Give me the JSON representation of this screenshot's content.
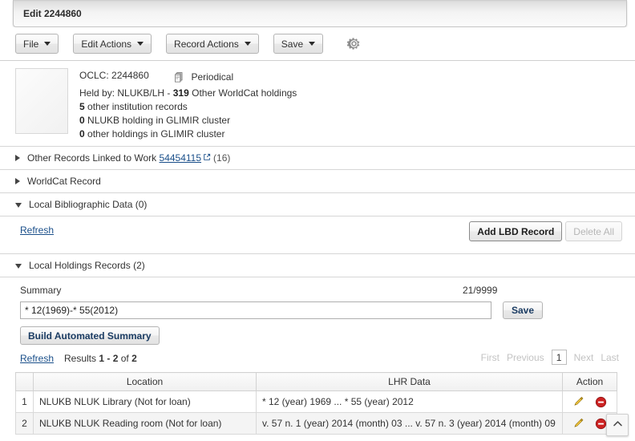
{
  "window": {
    "tab_title": "Edit 2244860"
  },
  "toolbar": {
    "file": "File",
    "edit_actions": "Edit Actions",
    "record_actions": "Record Actions",
    "save": "Save",
    "settings_icon": "gear-icon"
  },
  "record": {
    "oclc_label": "OCLC:",
    "oclc_number": "2244860",
    "material_type": "Periodical",
    "material_icon": "periodical-icon",
    "held_by_label": "Held by:",
    "held_by_value": "NLUKB/LH -",
    "other_holdings_count": "319",
    "other_holdings_text": "Other WorldCat holdings",
    "other_institution_count": "5",
    "other_institution_text": "other institution records",
    "glimir_nlukb_count": "0",
    "glimir_nlukb_text": "NLUKB holding in GLIMIR cluster",
    "glimir_other_count": "0",
    "glimir_other_text": "other holdings in GLIMIR cluster"
  },
  "sections": {
    "other_records": {
      "label": "Other Records Linked to Work",
      "link": "54454115",
      "count": "(16)",
      "expanded": false
    },
    "worldcat_record": {
      "label": "WorldCat Record",
      "expanded": false
    },
    "local_bib_data": {
      "label": "Local Bibliographic Data (0)",
      "expanded": true,
      "refresh": "Refresh",
      "add_button": "Add LBD Record",
      "delete_button": "Delete All"
    },
    "local_holdings": {
      "label": "Local Holdings Records (2)",
      "expanded": true
    }
  },
  "summary": {
    "label": "Summary",
    "counter": "21/9999",
    "value": "* 12(1969)-* 55(2012)",
    "save_button": "Save",
    "build_button": "Build Automated Summary"
  },
  "results": {
    "refresh": "Refresh",
    "results_prefix": "Results",
    "results_range": "1 - 2",
    "results_middle": "of",
    "results_total": "2",
    "pager": {
      "first": "First",
      "previous": "Previous",
      "current_page": "1",
      "next": "Next",
      "last": "Last"
    },
    "columns": [
      "",
      "Location",
      "LHR Data",
      "Action"
    ],
    "rows": [
      {
        "num": "1",
        "location": "NLUKB NLUK Library (Not for loan)",
        "lhr_data": "* 12 (year) 1969 ... * 55 (year) 2012",
        "edit_icon": "pencil-icon",
        "delete_icon": "delete-circle-icon"
      },
      {
        "num": "2",
        "location": "NLUKB NLUK Reading room (Not for loan)",
        "lhr_data": "v. 57 n. 1 (year) 2014 (month) 03 ... v. 57 n. 3 (year) 2014 (month) 09",
        "edit_icon": "pencil-icon",
        "delete_icon": "delete-circle-icon"
      }
    ]
  },
  "scroll_top": {
    "icon": "chevron-up-icon"
  },
  "colors": {
    "link": "#1a4f8a",
    "edit_icon": "#f2c53d",
    "delete_icon": "#cc2222",
    "disabled_text": "#b6b6b6"
  }
}
